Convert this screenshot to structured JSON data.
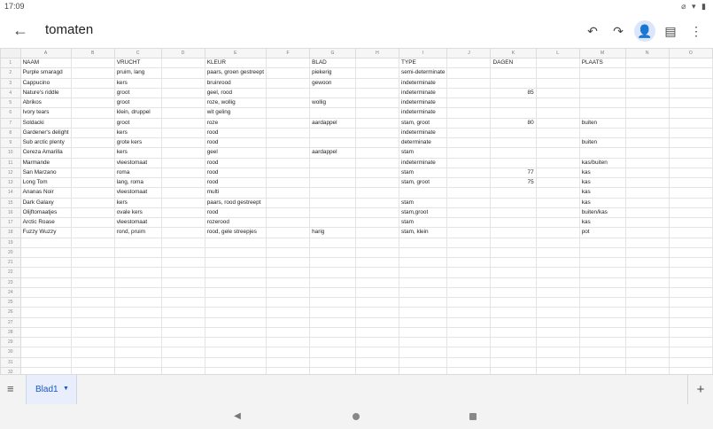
{
  "status": {
    "time": "17:09",
    "icons": "⌀ ▾ ▮"
  },
  "appbar": {
    "title": "tomaten",
    "back_icon": "←",
    "undo_icon": "↶",
    "redo_icon": "↷",
    "share_icon": "👤",
    "comment_icon": "▤",
    "more_icon": "⋮"
  },
  "sheet": {
    "columns": [
      "A",
      "B",
      "C",
      "D",
      "E",
      "F",
      "G",
      "H",
      "I",
      "J",
      "K",
      "L",
      "M",
      "N",
      "O"
    ],
    "rows": [
      [
        "NAAM",
        "",
        "VRUCHT",
        "",
        "KLEUR",
        "",
        "BLAD",
        "",
        "TYPE",
        "",
        "DAGEN",
        "",
        "PLAATS",
        "",
        ""
      ],
      [
        "Purple smaragd",
        "",
        "pruim, lang",
        "",
        "paars, groen gestreept",
        "",
        "piekerig",
        "",
        "semi-determinate",
        "",
        "",
        "",
        "",
        "",
        ""
      ],
      [
        "Cappucino",
        "",
        "kers",
        "",
        "bruinrood",
        "",
        "gewoon",
        "",
        "indeterminate",
        "",
        "",
        "",
        "",
        "",
        ""
      ],
      [
        "Nature's riddle",
        "",
        "groot",
        "",
        "geel, rood",
        "",
        "",
        "",
        "indeterminate",
        "",
        "85",
        "",
        "",
        "",
        ""
      ],
      [
        "Abrikos",
        "",
        "groot",
        "",
        "roze, wollig",
        "",
        "wollig",
        "",
        "indeterminate",
        "",
        "",
        "",
        "",
        "",
        ""
      ],
      [
        "Ivory tears",
        "",
        "klein, druppel",
        "",
        "wit geling",
        "",
        "",
        "",
        "indeterminate",
        "",
        "",
        "",
        "",
        "",
        ""
      ],
      [
        "Soldacki",
        "",
        "groot",
        "",
        "roze",
        "",
        "aardappel",
        "",
        "stam, groot",
        "",
        "80",
        "",
        "buiten",
        "",
        ""
      ],
      [
        "Gardener's delight",
        "",
        "kers",
        "",
        "rood",
        "",
        "",
        "",
        "indeterminate",
        "",
        "",
        "",
        "",
        "",
        ""
      ],
      [
        "Sub arctic plenty",
        "",
        "grote kers",
        "",
        "rood",
        "",
        "",
        "",
        "determinate",
        "",
        "",
        "",
        "buiten",
        "",
        ""
      ],
      [
        "Cereza Amarilla",
        "",
        "kers",
        "",
        "geel",
        "",
        "aardappel",
        "",
        "stam",
        "",
        "",
        "",
        "",
        "",
        ""
      ],
      [
        "Marmande",
        "",
        "vleestomaat",
        "",
        "rood",
        "",
        "",
        "",
        "indeterminate",
        "",
        "",
        "",
        "kas/buiten",
        "",
        ""
      ],
      [
        "San Marzano",
        "",
        "roma",
        "",
        "rood",
        "",
        "",
        "",
        "stam",
        "",
        "77",
        "",
        "kas",
        "",
        ""
      ],
      [
        "Long Tom",
        "",
        "lang, roma",
        "",
        "rood",
        "",
        "",
        "",
        "stam, groot",
        "",
        "75",
        "",
        "kas",
        "",
        ""
      ],
      [
        "Ananas Noir",
        "",
        "vleestomaat",
        "",
        "multi",
        "",
        "",
        "",
        "",
        "",
        "",
        "",
        "kas",
        "",
        ""
      ],
      [
        "Dark Galaxy",
        "",
        "kers",
        "",
        "paars, rood gestreept",
        "",
        "",
        "",
        "stam",
        "",
        "",
        "",
        "kas",
        "",
        ""
      ],
      [
        "Olijftomaatjes",
        "",
        "ovale kers",
        "",
        "rood",
        "",
        "",
        "",
        "stam,groot",
        "",
        "",
        "",
        "buiten/kas",
        "",
        ""
      ],
      [
        "Arctic Roase",
        "",
        "vleestomaat",
        "",
        "rozerood",
        "",
        "",
        "",
        "stam",
        "",
        "",
        "",
        "kas",
        "",
        ""
      ],
      [
        "Fuzzy Wuzzy",
        "",
        "rond, pruim",
        "",
        "rood, gele streepjes",
        "",
        "harig",
        "",
        "stam, klein",
        "",
        "",
        "",
        "pot",
        "",
        ""
      ]
    ],
    "total_rows": 32
  },
  "tabs": {
    "menu_icon": "≡",
    "sheet_name": "Blad1",
    "dropdown_icon": "▼",
    "add_icon": "+"
  },
  "navbar": {
    "back_icon": "◀"
  }
}
